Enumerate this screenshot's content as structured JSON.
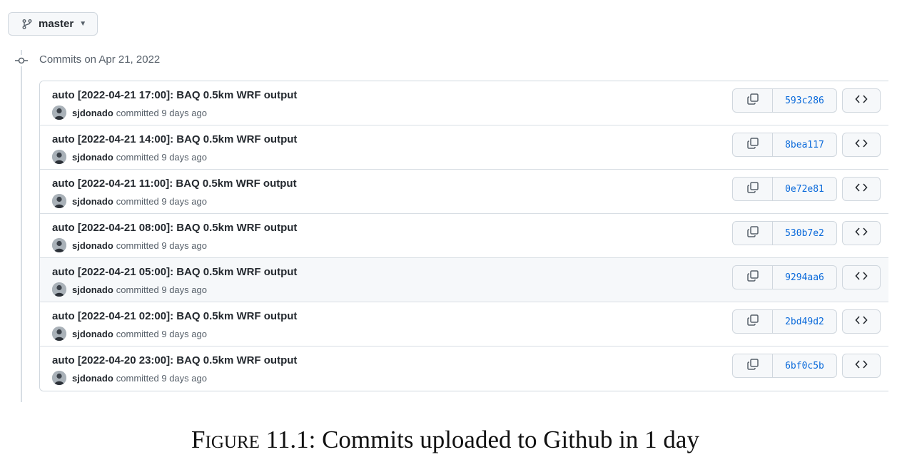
{
  "branch": {
    "name": "master",
    "icon": "git-branch-icon"
  },
  "timeline": {
    "date_header": "Commits on Apr 21, 2022",
    "icon": "git-commit-icon"
  },
  "commits": [
    {
      "title": "auto [2022-04-21 17:00]: BAQ 0.5km WRF output",
      "author": "sjdonado",
      "meta": "committed 9 days ago",
      "sha": "593c286"
    },
    {
      "title": "auto [2022-04-21 14:00]: BAQ 0.5km WRF output",
      "author": "sjdonado",
      "meta": "committed 9 days ago",
      "sha": "8bea117"
    },
    {
      "title": "auto [2022-04-21 11:00]: BAQ 0.5km WRF output",
      "author": "sjdonado",
      "meta": "committed 9 days ago",
      "sha": "0e72e81"
    },
    {
      "title": "auto [2022-04-21 08:00]: BAQ 0.5km WRF output",
      "author": "sjdonado",
      "meta": "committed 9 days ago",
      "sha": "530b7e2"
    },
    {
      "title": "auto [2022-04-21 05:00]: BAQ 0.5km WRF output",
      "author": "sjdonado",
      "meta": "committed 9 days ago",
      "sha": "9294aa6"
    },
    {
      "title": "auto [2022-04-21 02:00]: BAQ 0.5km WRF output",
      "author": "sjdonado",
      "meta": "committed 9 days ago",
      "sha": "2bd49d2"
    },
    {
      "title": "auto [2022-04-20 23:00]: BAQ 0.5km WRF output",
      "author": "sjdonado",
      "meta": "committed 9 days ago",
      "sha": "6bf0c5b"
    }
  ],
  "caption": {
    "prefix": "Figure",
    "text": "11.1: Commits uploaded to Github in 1 day"
  },
  "colors": {
    "link": "#0969da",
    "border": "#d0d7de",
    "muted": "#57606a",
    "row_hover": "#f6f8fa"
  }
}
